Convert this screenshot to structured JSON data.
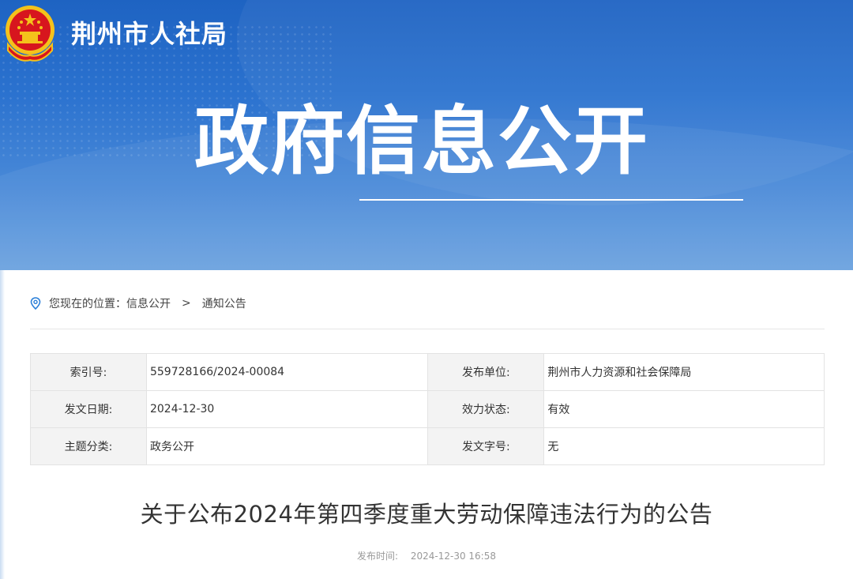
{
  "header": {
    "site_name": "荆州市人社局",
    "banner_title": "政府信息公开"
  },
  "breadcrumb": {
    "prefix": "您现在的位置：",
    "items": [
      "信息公开",
      "通知公告"
    ],
    "separator": ">"
  },
  "meta": {
    "rows": [
      {
        "label1": "索引号:",
        "value1": "559728166/2024-00084",
        "label2": "发布单位:",
        "value2": "荆州市人力资源和社会保障局"
      },
      {
        "label1": "发文日期:",
        "value1": "2024-12-30",
        "label2": "效力状态:",
        "value2": "有效"
      },
      {
        "label1": "主题分类:",
        "value1": "政务公开",
        "label2": "发文字号:",
        "value2": "无"
      }
    ]
  },
  "article": {
    "title": "关于公布2024年第四季度重大劳动保障违法行为的公告",
    "pubtime_label": "发布时间:",
    "pubtime_value": "2024-12-30 16:58"
  },
  "colors": {
    "banner_top": "#1e63c2",
    "banner_bottom": "#6ba2df",
    "emblem_red": "#d7161e",
    "emblem_gold": "#f4c21b"
  },
  "icons": [
    "national-emblem-icon",
    "location-pin-icon"
  ]
}
